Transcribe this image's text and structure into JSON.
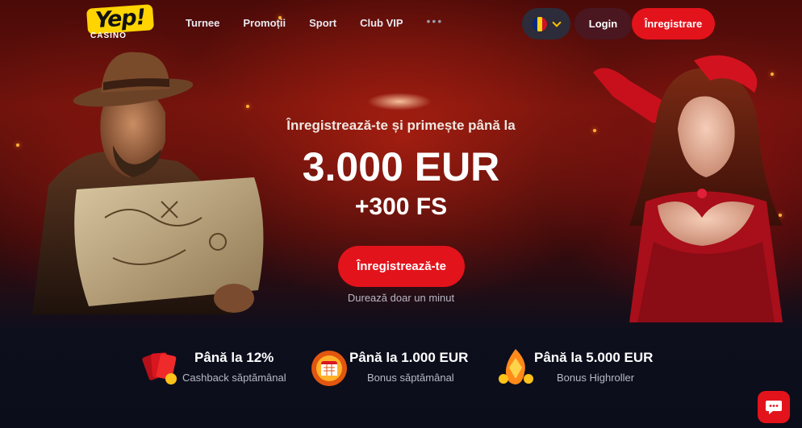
{
  "nav": {
    "logo_text": "Yep!",
    "logo_sub": "CASINO",
    "links": [
      "Turnee",
      "Promoții",
      "Sport",
      "Club VIP"
    ],
    "more": "•••",
    "language_flag_colors": [
      "#002b7f",
      "#fcd116",
      "#ce1126"
    ],
    "login_label": "Login",
    "register_label": "Înregistrare"
  },
  "hero": {
    "subtitle": "Înregistrează-te și primește până la",
    "amount": "3.000 EUR",
    "free_spins": "+300 FS",
    "cta_label": "Înregistrează-te",
    "cta_note": "Durează doar un minut"
  },
  "bonuses": [
    {
      "title": "Până la 12%",
      "subtitle": "Cashback săptămânal",
      "icon": "cards-icon"
    },
    {
      "title": "Până la 1.000 EUR",
      "subtitle": "Bonus săptămânal",
      "icon": "calendar-fire-icon"
    },
    {
      "title": "Până la 5.000 EUR",
      "subtitle": "Bonus Highroller",
      "icon": "fire-crystal-icon"
    }
  ],
  "colors": {
    "accent": "#e3131c",
    "logo": "#ffd400",
    "login_bg": "#4a1620",
    "lang_bg": "#2c2c3a"
  }
}
